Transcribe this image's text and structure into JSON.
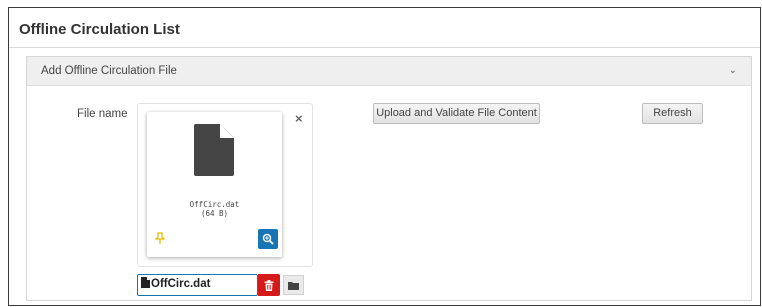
{
  "page": {
    "title": "Offline Circulation List"
  },
  "section": {
    "title": "Add Offline Circulation File",
    "expanded_icon": "chevron-down-icon"
  },
  "form": {
    "field_label": "File name",
    "preview": {
      "file_name": "OffCirc.dat",
      "file_size": "(64 B)"
    },
    "selected_file_value": "OffCirc.dat"
  },
  "actions": {
    "upload_label": "Upload and Validate File Content",
    "refresh_label": "Refresh"
  },
  "colors": {
    "accent": "#1775b5",
    "danger": "#d51a1a",
    "pin": "#e6b800"
  }
}
